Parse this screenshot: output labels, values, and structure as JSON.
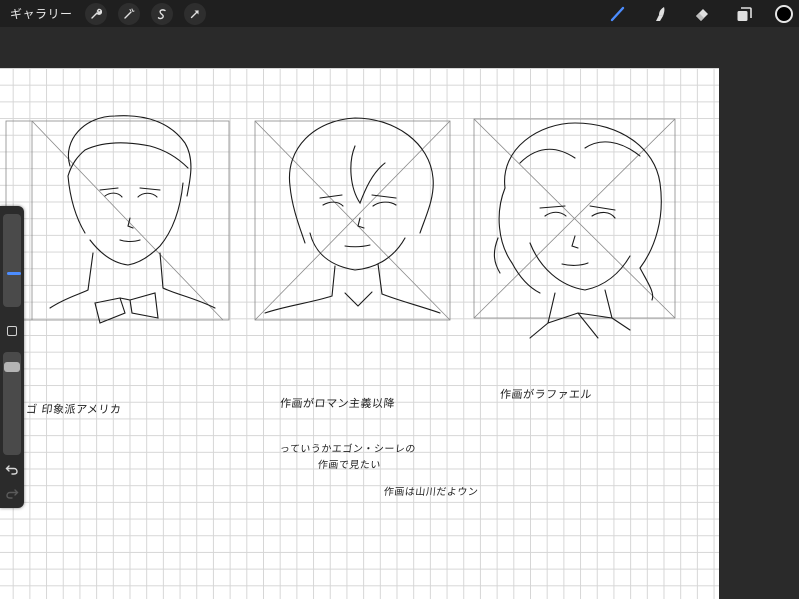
{
  "topbar": {
    "gallery_label": "ギャラリー",
    "left_tools": [
      {
        "name": "actions-wrench-icon"
      },
      {
        "name": "adjustments-wand-icon"
      },
      {
        "name": "selection-s-icon"
      },
      {
        "name": "transform-arrow-icon"
      }
    ],
    "right_tools": [
      {
        "name": "brush-icon",
        "active": true
      },
      {
        "name": "smudge-icon",
        "active": false
      },
      {
        "name": "eraser-icon",
        "active": false
      },
      {
        "name": "layers-icon",
        "active": false
      }
    ],
    "current_color": "#000000",
    "accent_color": "#4c8dff"
  },
  "canvas": {
    "notes": [
      "ゴ 印象派アメリカ",
      "作画がロマン主義以降",
      "作画がラファエル",
      "っていうかエゴン・シーレの",
      "作画で見たい",
      "作画は山川だよウン"
    ]
  },
  "sidebar": {
    "brush_size": 0.27,
    "opacity": 0.95
  }
}
